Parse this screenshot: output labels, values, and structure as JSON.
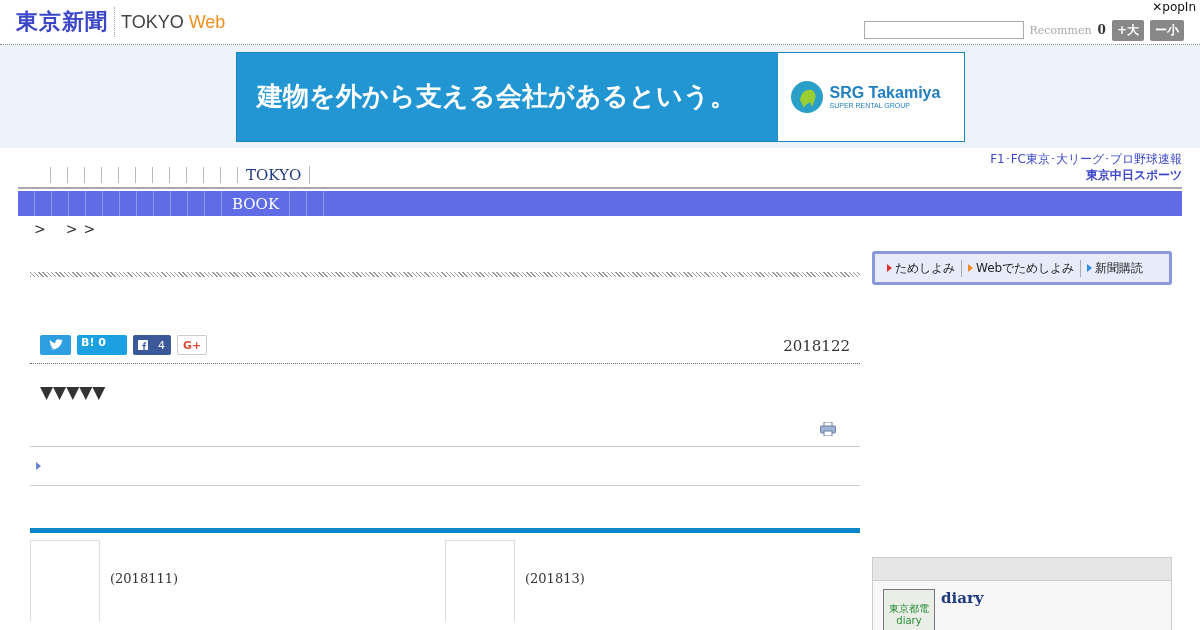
{
  "header": {
    "logo": "東京新聞",
    "site": "TOKYO ",
    "site_accent": "Web",
    "recommend": "Recommen",
    "count": "0",
    "font_buttons": [
      "+大",
      "ー小"
    ],
    "popin": "✕popIn"
  },
  "ad": {
    "headline": "建物を外から支える会社があるという。",
    "brand": "SRG Takamiya",
    "tagline": "SUPER RENTAL GROUP"
  },
  "nav": {
    "items": [
      "TOKYO"
    ],
    "sports_caption": "F1･FC東京･大リーグ･プロ野球速報",
    "sports_link": "東京中日スポーツ"
  },
  "menu_bar": {
    "items": [
      "BOOK"
    ]
  },
  "breadcrumb": [
    ">",
    ">",
    ">"
  ],
  "trial_links": [
    {
      "label": "ためしよみ",
      "color": "#e03030"
    },
    {
      "label": "Webでためしよみ",
      "color": "#f08a20"
    },
    {
      "label": "新聞購読",
      "color": "#2a8ee0"
    }
  ],
  "share": {
    "hatena_label": "B!",
    "hatena_count": "0",
    "facebook_count": "4",
    "gplus": "G+"
  },
  "date": "2018122",
  "marks": "▼▼▼▼▼",
  "related": [
    {
      "date": "(2018111)"
    },
    {
      "date": "(201813)"
    }
  ],
  "sidebar": {
    "diary": {
      "title": "diary",
      "thumb_caption": "東京都電",
      "thumb_word": "diary"
    }
  }
}
